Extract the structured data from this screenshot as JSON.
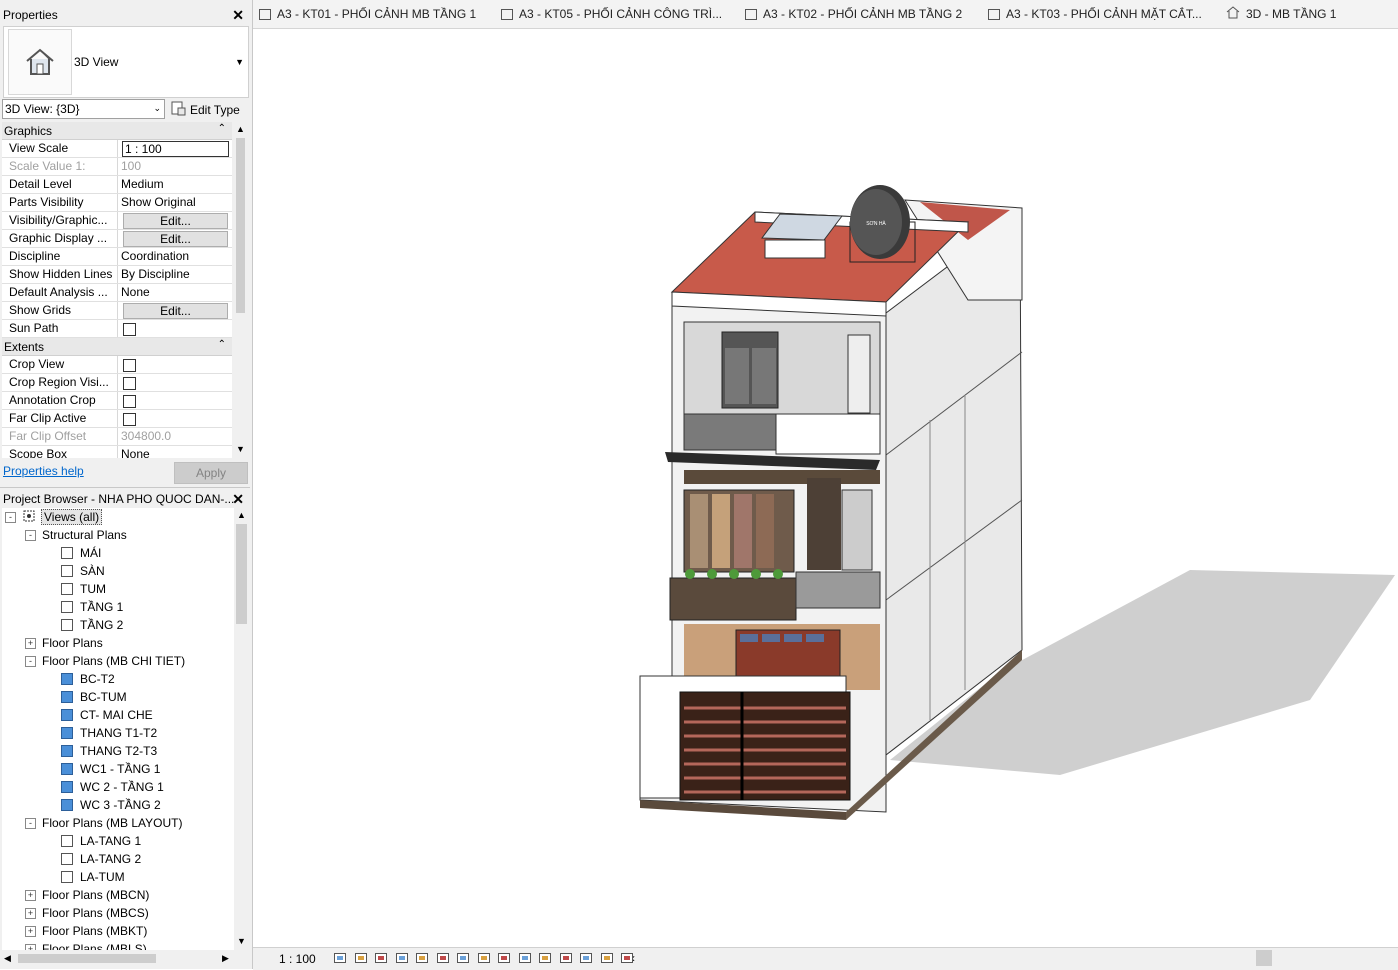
{
  "properties": {
    "title": "Properties",
    "type_name": "3D View",
    "view_selector": "3D View: {3D}",
    "edit_type": "Edit Type",
    "groups": [
      {
        "name": "Graphics",
        "rows": [
          {
            "key": "View Scale",
            "value": "1 : 100",
            "kind": "input"
          },
          {
            "key": "Scale Value    1:",
            "value": "100",
            "kind": "dim"
          },
          {
            "key": "Detail Level",
            "value": "Medium",
            "kind": "text"
          },
          {
            "key": "Parts Visibility",
            "value": "Show Original",
            "kind": "text"
          },
          {
            "key": "Visibility/Graphic...",
            "value": "Edit...",
            "kind": "button"
          },
          {
            "key": "Graphic Display ...",
            "value": "Edit...",
            "kind": "button"
          },
          {
            "key": "Discipline",
            "value": "Coordination",
            "kind": "text"
          },
          {
            "key": "Show Hidden Lines",
            "value": "By Discipline",
            "kind": "text"
          },
          {
            "key": "Default Analysis ...",
            "value": "None",
            "kind": "text"
          },
          {
            "key": "Show Grids",
            "value": "Edit...",
            "kind": "button"
          },
          {
            "key": "Sun Path",
            "value": "",
            "kind": "check"
          }
        ]
      },
      {
        "name": "Extents",
        "rows": [
          {
            "key": "Crop View",
            "value": "",
            "kind": "check"
          },
          {
            "key": "Crop Region Visi...",
            "value": "",
            "kind": "check"
          },
          {
            "key": "Annotation Crop",
            "value": "",
            "kind": "check"
          },
          {
            "key": "Far Clip Active",
            "value": "",
            "kind": "check"
          },
          {
            "key": "Far Clip Offset",
            "value": "304800.0",
            "kind": "dim"
          },
          {
            "key": "Scope Box",
            "value": "None",
            "kind": "text"
          }
        ]
      }
    ],
    "help_link": "Properties help",
    "apply": "Apply"
  },
  "browser": {
    "title": "Project Browser - NHA PHO QUOC DAN-...",
    "nodes": [
      {
        "label": "Views (all)",
        "level": 0,
        "toggle": "-",
        "icon": "views",
        "selected": true
      },
      {
        "label": "Structural Plans",
        "level": 1,
        "toggle": "-"
      },
      {
        "label": "MÁI",
        "level": 2,
        "icon": "plain"
      },
      {
        "label": "SÀN",
        "level": 2,
        "icon": "plain"
      },
      {
        "label": "TUM",
        "level": 2,
        "icon": "plain"
      },
      {
        "label": "TẦNG 1",
        "level": 2,
        "icon": "plain"
      },
      {
        "label": "TẦNG 2",
        "level": 2,
        "icon": "plain"
      },
      {
        "label": "Floor Plans",
        "level": 1,
        "toggle": "+"
      },
      {
        "label": "Floor Plans (MB CHI TIET)",
        "level": 1,
        "toggle": "-"
      },
      {
        "label": "BC-T2",
        "level": 2,
        "icon": "blue"
      },
      {
        "label": "BC-TUM",
        "level": 2,
        "icon": "blue"
      },
      {
        "label": "CT- MAI CHE",
        "level": 2,
        "icon": "blue"
      },
      {
        "label": "THANG T1-T2",
        "level": 2,
        "icon": "blue"
      },
      {
        "label": "THANG T2-T3",
        "level": 2,
        "icon": "blue"
      },
      {
        "label": "WC1 - TẦNG 1",
        "level": 2,
        "icon": "blue"
      },
      {
        "label": "WC 2 - TẦNG 1",
        "level": 2,
        "icon": "blue"
      },
      {
        "label": "WC 3 -TẦNG 2",
        "level": 2,
        "icon": "blue"
      },
      {
        "label": "Floor Plans (MB LAYOUT)",
        "level": 1,
        "toggle": "-"
      },
      {
        "label": "LA-TANG 1",
        "level": 2,
        "icon": "plain"
      },
      {
        "label": "LA-TANG 2",
        "level": 2,
        "icon": "plain"
      },
      {
        "label": "LA-TUM",
        "level": 2,
        "icon": "plain"
      },
      {
        "label": "Floor Plans (MBCN)",
        "level": 1,
        "toggle": "+"
      },
      {
        "label": "Floor Plans (MBCS)",
        "level": 1,
        "toggle": "+"
      },
      {
        "label": "Floor Plans (MBKT)",
        "level": 1,
        "toggle": "+"
      },
      {
        "label": "Floor Plans (MBLS)",
        "level": 1,
        "toggle": "+"
      }
    ]
  },
  "tabs": [
    {
      "label": "A3 - KT01 - PHỐI CẢNH MB TẦNG 1",
      "icon": "sheet"
    },
    {
      "label": "A3 - KT05 - PHỐI CẢNH CÔNG TRÌ...",
      "icon": "sheet"
    },
    {
      "label": "A3 - KT02 - PHỐI CẢNH MB TẦNG 2",
      "icon": "sheet"
    },
    {
      "label": "A3 - KT03 - PHỐI CẢNH MẶT CẮT...",
      "icon": "sheet"
    },
    {
      "label": "3D -  MB TẦNG 1",
      "icon": "3d-house"
    }
  ],
  "tank_label": "SƠN HÀ",
  "status": {
    "scale": "1 : 100",
    "icons": [
      "detail-level-icon",
      "visual-style-icon",
      "sun-path-icon",
      "shadows-icon",
      "render-icon",
      "crop-icon",
      "crop-region-icon",
      "unlock-3d-icon",
      "temp-hide-icon",
      "reveal-hidden-icon",
      "worksharing-icon",
      "analytical-icon",
      "highlight-icon",
      "constraints-icon",
      "lock-icon"
    ]
  },
  "colors": {
    "accent_blue": "#4a8fd8",
    "roof_red": "#c85a4a",
    "link": "#0066cc"
  }
}
